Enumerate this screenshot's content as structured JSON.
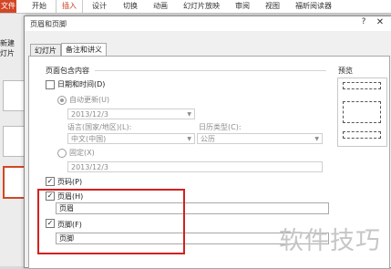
{
  "ribbon": {
    "file_tab": "文件",
    "tabs": [
      "开始",
      "插入",
      "设计",
      "切换",
      "动画",
      "幻灯片放映",
      "审阅",
      "视图",
      "福昕阅读器"
    ],
    "active_tab": "插入"
  },
  "left_pane": {
    "new_slide_label_line1": "新建",
    "new_slide_label_line2": "灯片"
  },
  "dialog": {
    "title": "页眉和页脚",
    "help": "?",
    "close": "✕",
    "tabs": [
      "幻灯片",
      "备注和讲义"
    ],
    "active_tab_index": 1,
    "section_title": "页面包含内容",
    "date_time": {
      "label": "日期和时间(D)",
      "checked": false
    },
    "auto_update": {
      "label": "自动更新(U)",
      "selected": true,
      "value": "2013/12/3"
    },
    "language": {
      "label": "语言(国家/地区)(L):",
      "value": "中文(中国)"
    },
    "calendar": {
      "label": "日历类型(C):",
      "value": "公历"
    },
    "fixed": {
      "label": "固定(X)",
      "selected": false,
      "value": "2013/12/3"
    },
    "page_number": {
      "label": "页码(P)",
      "checked": true
    },
    "header": {
      "label": "页眉(H)",
      "checked": true,
      "value": "页眉"
    },
    "footer": {
      "label": "页脚(F)",
      "checked": true,
      "value": "页脚"
    },
    "preview_title": "预览"
  },
  "watermark": "软件技巧",
  "colors": {
    "highlight_box": "#d32020",
    "file_tab": "#d24726",
    "active_tab_text": "#c43e1c"
  }
}
